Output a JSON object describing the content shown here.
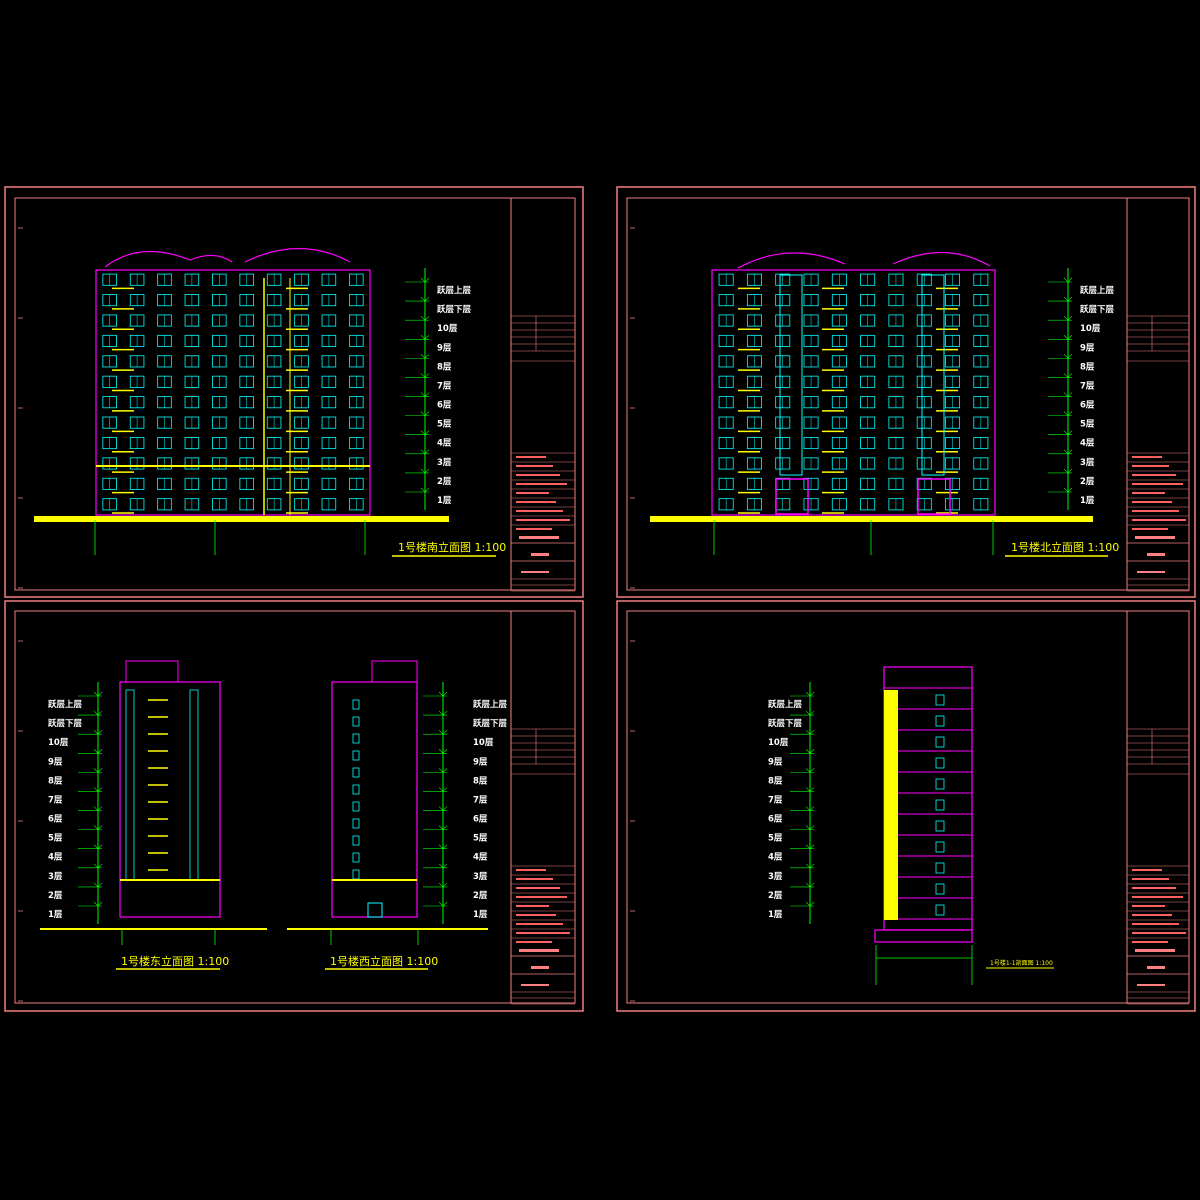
{
  "colors": {
    "background": "#000000",
    "frame": "#f08080",
    "wall": "#ff00ff",
    "window": "#00ffff",
    "balcony": "#ffff00",
    "ground": "#ffff00",
    "level_marks": "#00ff00",
    "text": "#ffffff"
  },
  "sheets": [
    {
      "caption": "1号楼南立面图 1:100",
      "levels": [
        "跃层上层",
        "跃层下层",
        "10层",
        "9层",
        "8层",
        "7层",
        "6层",
        "5层",
        "4层",
        "3层",
        "2层",
        "1层"
      ]
    },
    {
      "caption": "1号楼北立面图 1:100",
      "levels": [
        "跃层上层",
        "跃层下层",
        "10层",
        "9层",
        "8层",
        "7层",
        "6层",
        "5层",
        "4层",
        "3层",
        "2层",
        "1层"
      ]
    },
    {
      "captions": [
        "1号楼东立面图 1:100",
        "1号楼西立面图 1:100"
      ],
      "levels": [
        "跃层上层",
        "跃层下层",
        "10层",
        "9层",
        "8层",
        "7层",
        "6层",
        "5层",
        "4层",
        "3层",
        "2层",
        "1层"
      ]
    },
    {
      "caption": "1号楼1-1剖面图 1:100",
      "levels": [
        "跃层上层",
        "跃层下层",
        "10层",
        "9层",
        "8层",
        "7层",
        "6层",
        "5层",
        "4层",
        "3层",
        "2层",
        "1层"
      ]
    }
  ]
}
